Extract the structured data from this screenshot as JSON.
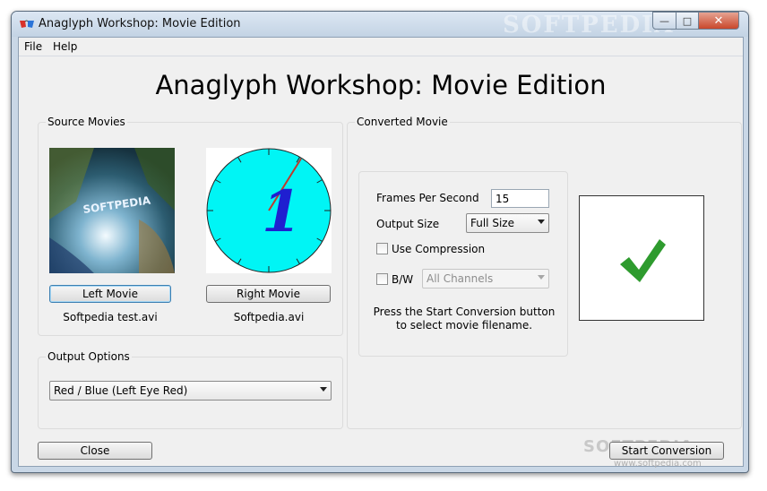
{
  "window": {
    "title": "Anaglyph Workshop: Movie Edition",
    "watermark": "SOFTPEDIA",
    "min_glyph": "—",
    "max_glyph": "□",
    "close_glyph": "✕"
  },
  "menu": {
    "file": "File",
    "help": "Help"
  },
  "heading": "Anaglyph Workshop: Movie Edition",
  "source": {
    "group_label": "Source Movies",
    "left_button": "Left Movie",
    "right_button": "Right Movie",
    "left_filename": "Softpedia test.avi",
    "right_filename": "Softpedia.avi",
    "left_thumb_text": "SOFTPEDIA",
    "right_thumb_digit": "1"
  },
  "output": {
    "group_label": "Output Options",
    "mode": "Red / Blue (Left Eye Red)"
  },
  "converted": {
    "group_label": "Converted Movie",
    "fps_label": "Frames Per Second",
    "fps_value": "15",
    "size_label": "Output Size",
    "size_value": "Full Size",
    "compression_label": "Use Compression",
    "bw_label": "B/W",
    "channels_value": "All Channels",
    "note": "Press the Start Conversion button to select movie filename."
  },
  "footer": {
    "close_button": "Close",
    "start_button": "Start Conversion",
    "watermark_url": "www.softpedia.com",
    "watermark_logo": "SOFTPEDIA"
  },
  "colors": {
    "check_green": "#2e9b2e",
    "clock_face": "#00f5f5",
    "clock_digit": "#1f1fd0",
    "clock_hand": "#c0392b"
  }
}
